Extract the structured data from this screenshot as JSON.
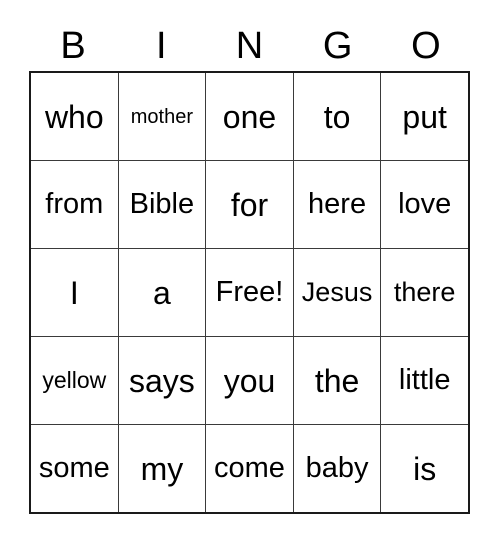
{
  "card": {
    "title_letters": [
      "B",
      "I",
      "N",
      "G",
      "O"
    ],
    "columns": 5,
    "rows": 5,
    "text_color": "#000000",
    "background_color": "#ffffff",
    "border_color": "#1a1a1a",
    "gridline_color": "#3a3a3a",
    "free_space": "Free!",
    "grid": [
      [
        {
          "text": "who",
          "size": "xl"
        },
        {
          "text": "mother",
          "size": "xs"
        },
        {
          "text": "one",
          "size": "xl"
        },
        {
          "text": "to",
          "size": "xl"
        },
        {
          "text": "put",
          "size": "xl"
        }
      ],
      [
        {
          "text": "from",
          "size": "l"
        },
        {
          "text": "Bible",
          "size": "l"
        },
        {
          "text": "for",
          "size": "xl"
        },
        {
          "text": "here",
          "size": "l"
        },
        {
          "text": "love",
          "size": "l"
        }
      ],
      [
        {
          "text": "I",
          "size": "xl"
        },
        {
          "text": "a",
          "size": "xl"
        },
        {
          "text": "Free!",
          "size": "l"
        },
        {
          "text": "Jesus",
          "size": "m"
        },
        {
          "text": "there",
          "size": "m"
        }
      ],
      [
        {
          "text": "yellow",
          "size": "s"
        },
        {
          "text": "says",
          "size": "xl"
        },
        {
          "text": "you",
          "size": "xl"
        },
        {
          "text": "the",
          "size": "xl"
        },
        {
          "text": "little",
          "size": "l"
        }
      ],
      [
        {
          "text": "some",
          "size": "l"
        },
        {
          "text": "my",
          "size": "xl"
        },
        {
          "text": "come",
          "size": "l"
        },
        {
          "text": "baby",
          "size": "l"
        },
        {
          "text": "is",
          "size": "xl"
        }
      ]
    ]
  }
}
